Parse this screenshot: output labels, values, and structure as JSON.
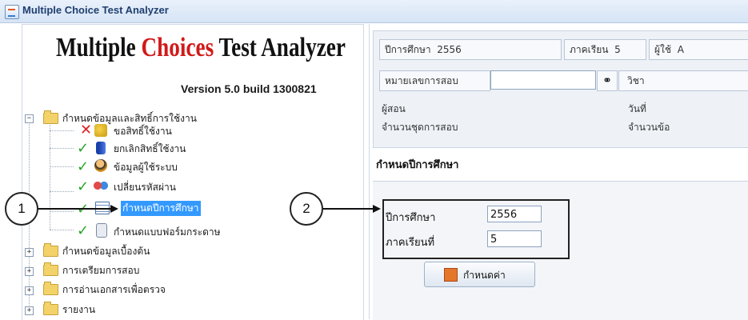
{
  "window": {
    "title": "Multiple Choice Test Analyzer"
  },
  "logo": {
    "part1": "Multiple ",
    "part2": "Choices",
    "part3": " Test Analyzer",
    "version": "Version 5.0  build 1300821",
    "accent": "#d11919"
  },
  "tree": {
    "root": "กำหนดข้อมูลและสิทธิ์การใช้งาน",
    "children": [
      {
        "label": "ขอสิทธิ์ใช้งาน",
        "icon": "key-x-icon"
      },
      {
        "label": "ยกเลิกสิทธิ์ใช้งาน",
        "icon": "book-icon"
      },
      {
        "label": "ข้อมูลผู้ใช้ระบบ",
        "icon": "user-icon"
      },
      {
        "label": "เปลี่ยนรหัสผ่าน",
        "icon": "keys-icon"
      },
      {
        "label": "กำหนดปีการศึกษา",
        "icon": "calendar-icon",
        "selected": true
      },
      {
        "label": "กำหนดแบบฟอร์มกระดาษ",
        "icon": "form-icon"
      }
    ],
    "folders": [
      "กำหนดข้อมูลเบื้องต้น",
      "การเตรียมการสอบ",
      "การอ่านเอกสารเพื่อตรวจ",
      "รายงาน"
    ]
  },
  "info": {
    "year_label": "ปีการศึกษา",
    "year_value": "2556",
    "term_label": "ภาคเรียน",
    "term_value": "5",
    "user_label": "ผู้ใช้",
    "user_value": "A",
    "exam_no_label": "หมายเลขการสอบ",
    "exam_no_value": "",
    "subject_label": "วิชา",
    "teacher_label": "ผู้สอน",
    "date_label": "วันที่",
    "sets_label": "จำนวนชุดการสอบ",
    "items_label": "จำนวนข้อ"
  },
  "section": {
    "title": "กำหนดปีการศึกษา"
  },
  "form": {
    "year_label": "ปีการศึกษา",
    "year_value": "2556",
    "term_label": "ภาคเรียนที่",
    "term_value": "5",
    "set_button": "กำหนดค่า"
  },
  "callouts": {
    "one": "1",
    "two": "2"
  }
}
